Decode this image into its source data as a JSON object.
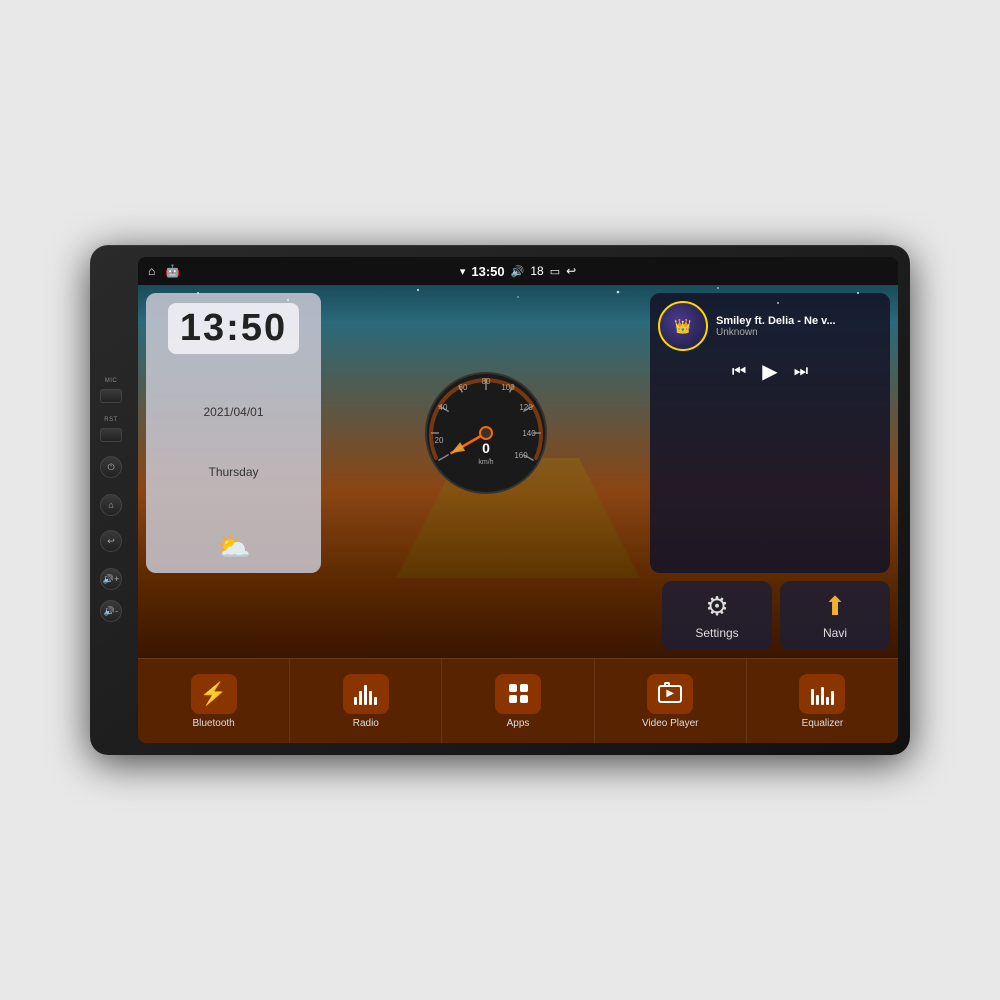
{
  "device": {
    "mic_label": "MIC",
    "rst_label": "RST"
  },
  "status_bar": {
    "home_icon": "⌂",
    "android_icon": "🤖",
    "time": "13:50",
    "wifi_icon": "▾",
    "volume_icon": "🔊",
    "volume_level": "18",
    "battery_icon": "🔋",
    "back_icon": "↩"
  },
  "clock": {
    "time": "13:50",
    "date": "2021/04/01",
    "day": "Thursday"
  },
  "music": {
    "title": "Smiley ft. Delia - Ne v...",
    "artist": "Unknown",
    "prev_icon": "⏮",
    "play_icon": "▶",
    "next_icon": "⏭"
  },
  "settings_btn": {
    "label": "Settings",
    "icon": "⚙"
  },
  "navi_btn": {
    "label": "Navi",
    "icon": "⬆"
  },
  "app_bar": {
    "items": [
      {
        "id": "bluetooth",
        "label": "Bluetooth"
      },
      {
        "id": "radio",
        "label": "Radio"
      },
      {
        "id": "apps",
        "label": "Apps"
      },
      {
        "id": "video",
        "label": "Video Player"
      },
      {
        "id": "equalizer",
        "label": "Equalizer"
      }
    ]
  },
  "speedometer": {
    "speed": "0",
    "unit": "km/h"
  }
}
